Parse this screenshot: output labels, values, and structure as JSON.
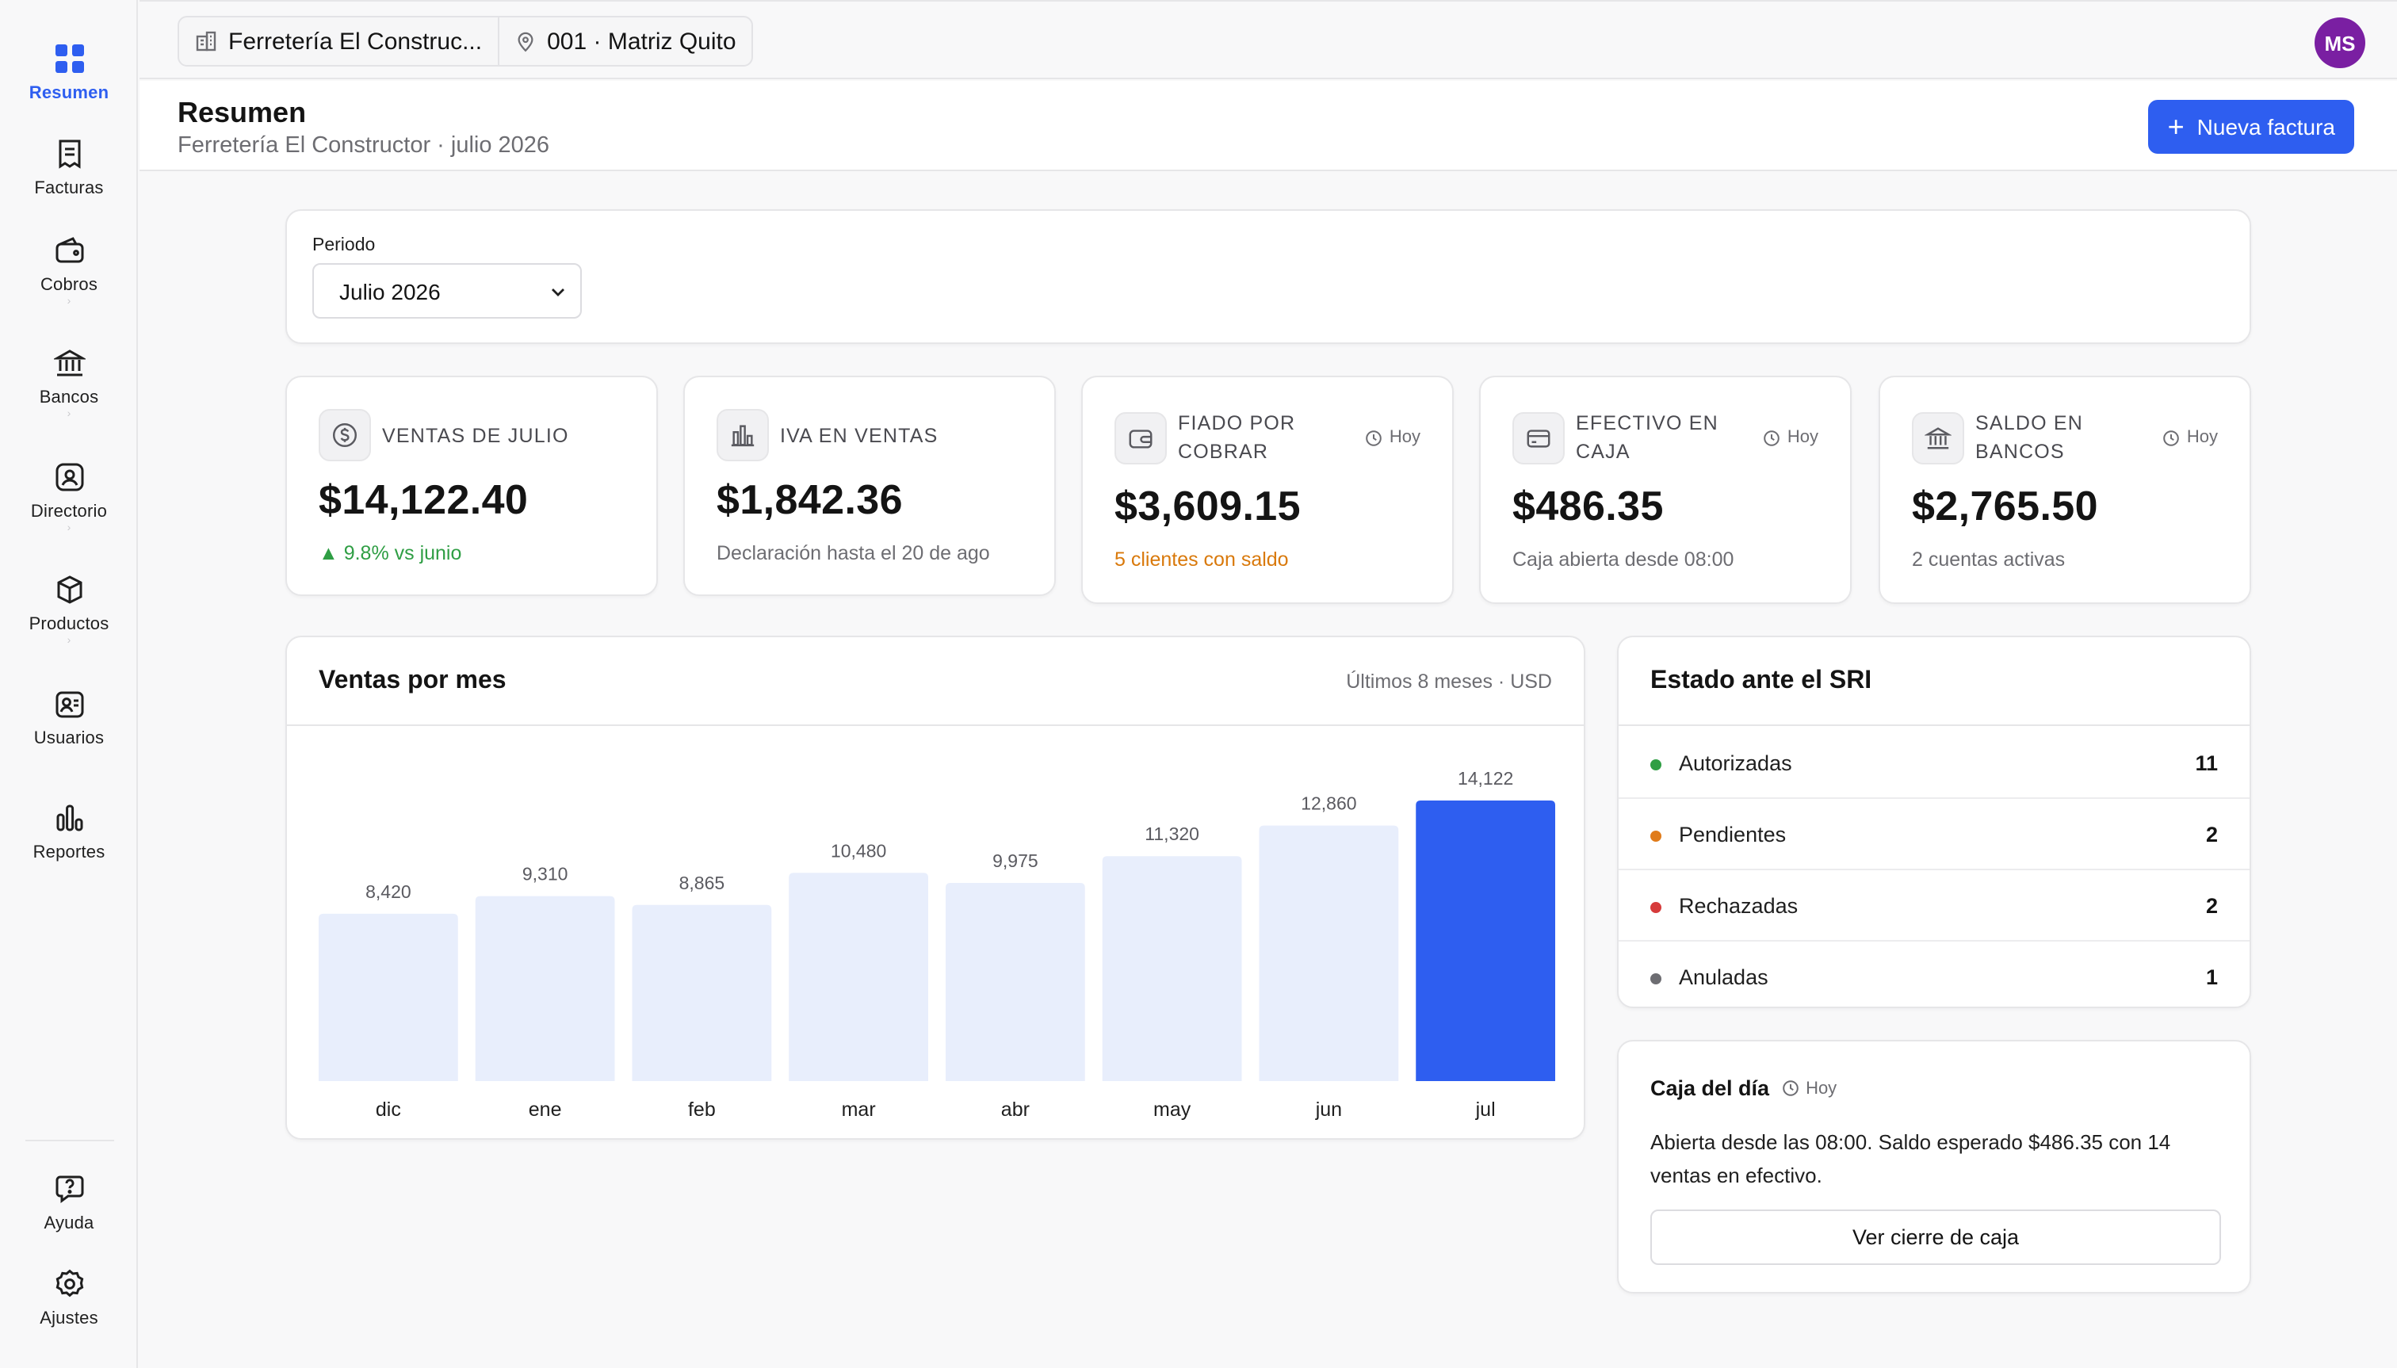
{
  "sidebar": {
    "items": [
      {
        "label": "Resumen",
        "icon": "grid-icon"
      },
      {
        "label": "Facturas",
        "icon": "receipt-icon"
      },
      {
        "label": "Cobros",
        "icon": "wallet-icon"
      },
      {
        "label": "Bancos",
        "icon": "bank-icon"
      },
      {
        "label": "Directorio",
        "icon": "contacts-icon"
      },
      {
        "label": "Productos",
        "icon": "box-icon"
      },
      {
        "label": "Usuarios",
        "icon": "users-icon"
      },
      {
        "label": "Reportes",
        "icon": "bar-chart-icon"
      }
    ],
    "bottom": [
      {
        "label": "Ayuda",
        "icon": "help-icon"
      },
      {
        "label": "Ajustes",
        "icon": "gear-icon"
      }
    ],
    "accent": "#2e5ef0"
  },
  "topbar": {
    "company": "Ferretería El Construc...",
    "branch": "001 · Matriz Quito",
    "avatar_initials": "MS",
    "avatar_color": "#7a1fa2"
  },
  "header": {
    "title": "Resumen",
    "subtitle": "Ferretería El Constructor · julio 2026",
    "new_invoice": "Nueva factura"
  },
  "period": {
    "label": "Periodo",
    "value": "Julio 2026"
  },
  "kpis": [
    {
      "title": "VENTAS DE JULIO",
      "value": "$14,122.40",
      "note": "▲ 9.8% vs junio",
      "icon": "dollar-icon"
    },
    {
      "title": "IVA EN VENTAS",
      "value": "$1,842.36",
      "note": "Declaración hasta el 20 de ago",
      "icon": "chart-icon"
    },
    {
      "title": "FIADO POR COBRAR",
      "value": "$3,609.15",
      "note": "5 clientes con saldo",
      "badge": "Hoy",
      "icon": "wallet-icon"
    },
    {
      "title": "EFECTIVO EN CAJA",
      "value": "$486.35",
      "note": "Caja abierta desde 08:00",
      "badge": "Hoy",
      "icon": "card-icon"
    },
    {
      "title": "SALDO EN BANCOS",
      "value": "$2,765.50",
      "note": "2 cuentas activas",
      "badge": "Hoy",
      "icon": "bank-icon"
    }
  ],
  "sales_chart": {
    "title": "Ventas por mes",
    "meta": "Últimos 8 meses · USD"
  },
  "chart_data": {
    "type": "bar",
    "title": "Ventas por mes",
    "categories": [
      "dic",
      "ene",
      "feb",
      "mar",
      "abr",
      "may",
      "jun",
      "jul"
    ],
    "values": [
      8420,
      9310,
      8865,
      10480,
      9975,
      11320,
      12860,
      14122
    ],
    "value_labels": [
      "8,420",
      "9,310",
      "8,865",
      "10,480",
      "9,975",
      "11,320",
      "12,860",
      "14,122"
    ],
    "highlight_index": 7,
    "colors": {
      "bar": "#e8eefc",
      "highlight": "#2e5ef0"
    },
    "ylim": [
      0,
      14122
    ],
    "grid": false,
    "legend": "none"
  },
  "sri": {
    "title": "Estado ante el SRI",
    "rows": [
      {
        "label": "Autorizadas",
        "count": "11",
        "color": "#2f9e44"
      },
      {
        "label": "Pendientes",
        "count": "2",
        "color": "#e07b1a"
      },
      {
        "label": "Rechazadas",
        "count": "2",
        "color": "#d63b3b"
      },
      {
        "label": "Anuladas",
        "count": "1",
        "color": "#6d6d72"
      }
    ]
  },
  "caja": {
    "title": "Caja del día",
    "badge": "Hoy",
    "text": "Abierta desde las 08:00. Saldo esperado $486.35 con 14 ventas en efectivo.",
    "button": "Ver cierre de caja"
  }
}
